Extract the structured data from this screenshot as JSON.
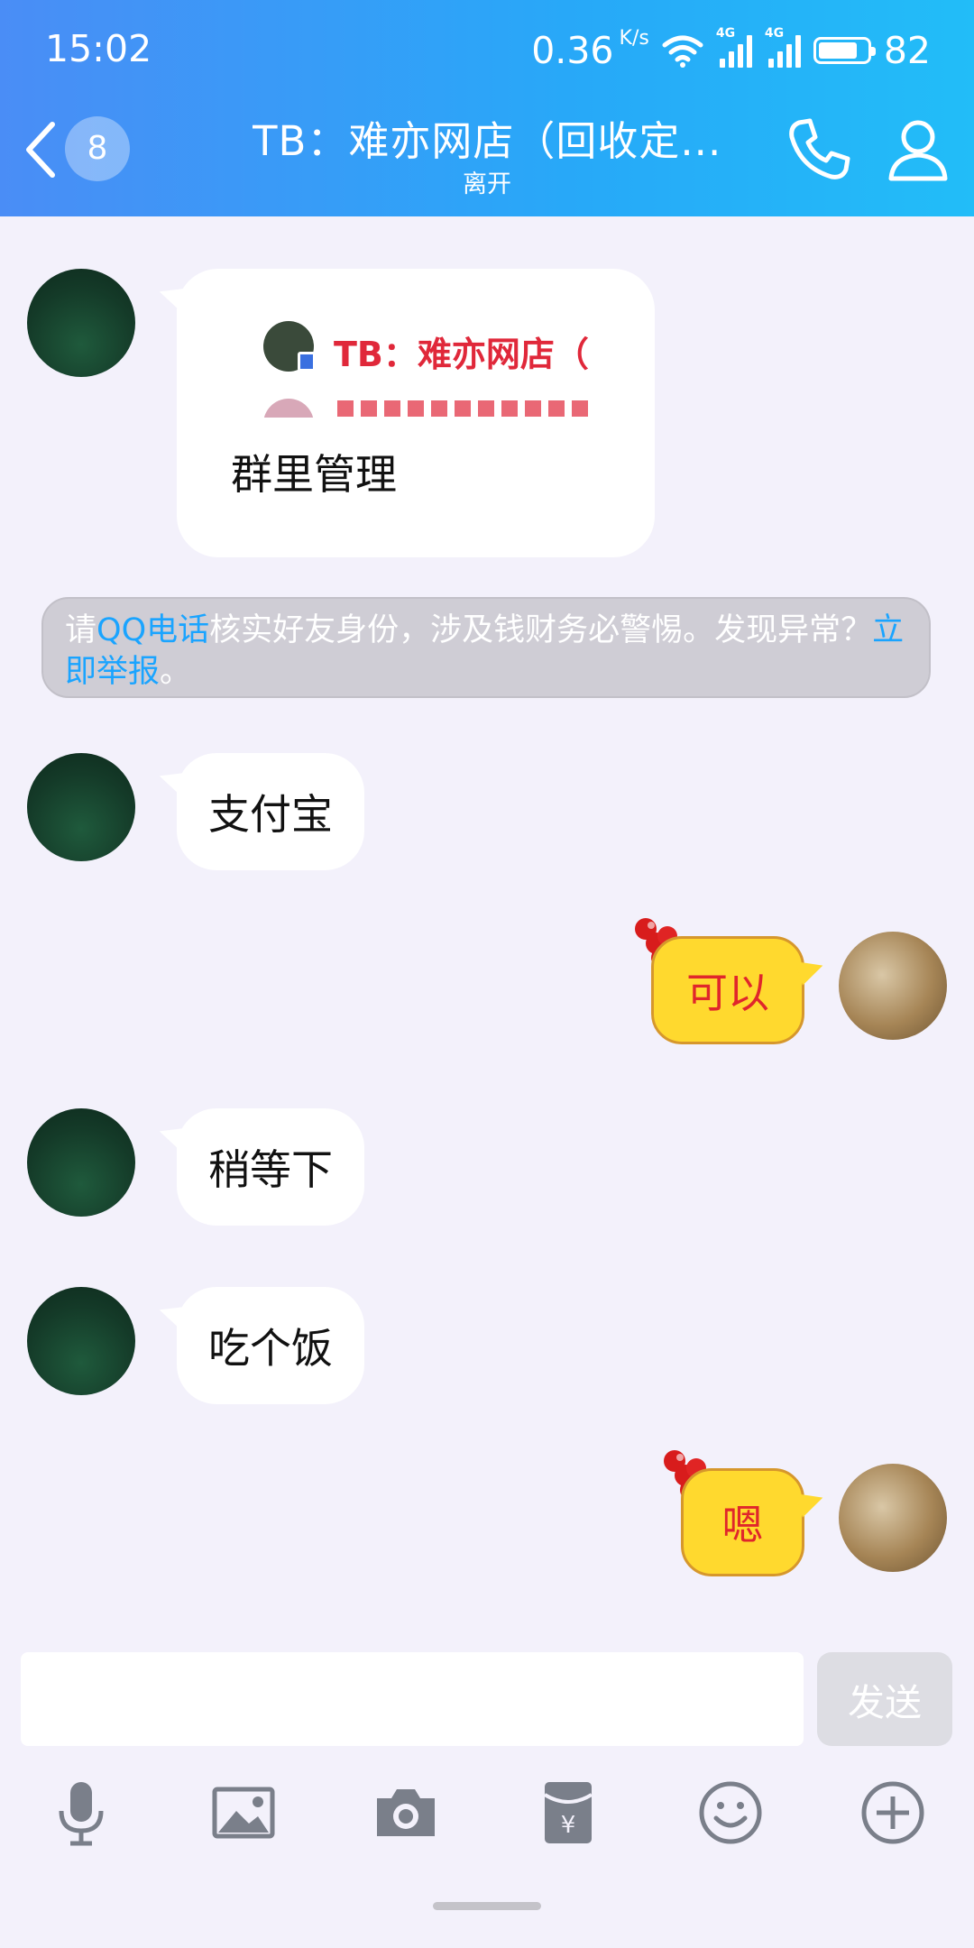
{
  "status_bar": {
    "time": "15:02",
    "speed": "0.36",
    "speed_unit": "K/s",
    "net1": "4G",
    "net2": "4G",
    "battery": "82"
  },
  "header": {
    "unread": "8",
    "title": "TB：难亦网店（回收定...",
    "subtitle": "离开"
  },
  "messages": [
    {
      "quote_text": "TB：难亦网店（",
      "caption": "群里管理"
    },
    {
      "text": "支付宝"
    },
    {
      "text": "可以"
    },
    {
      "text": "稍等下"
    },
    {
      "text": "吃个饭"
    },
    {
      "text": "嗯"
    }
  ],
  "notice": {
    "part1": "请",
    "link1": "QQ电话",
    "part2": "核实好友身份，涉及钱财务必警惕。发现异常？",
    "link2": "立即举报",
    "part3": "。"
  },
  "input": {
    "value": "",
    "send_label": "发送"
  },
  "toolbar": [
    "microphone-icon",
    "image-icon",
    "camera-icon",
    "red-packet-icon",
    "emoji-icon",
    "plus-icon"
  ],
  "colors": {
    "header_start": "#4a8df6",
    "header_end": "#22bdf8",
    "link": "#1aa4ff",
    "my_bubble": "#ffd92e",
    "my_text": "#e0262b"
  }
}
